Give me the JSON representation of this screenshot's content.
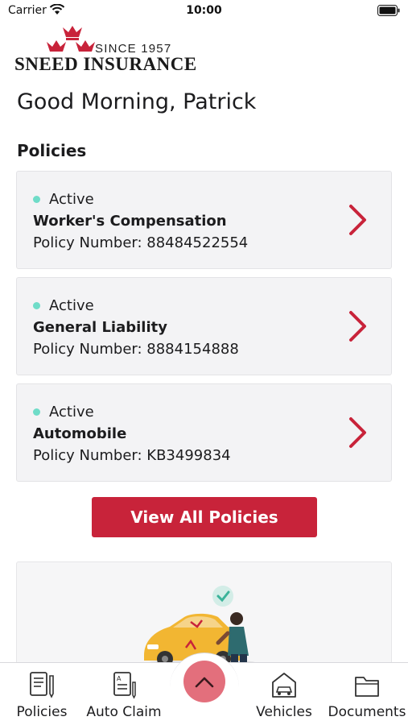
{
  "status_bar": {
    "carrier": "Carrier",
    "time": "10:00",
    "icons": [
      "wifi-icon",
      "battery-icon"
    ]
  },
  "logo": {
    "since": "SINCE 1957",
    "name": "SNEED INSURANCE",
    "icon": "crown-icon",
    "colors": {
      "crown": "#c8233a",
      "text": "#1a1a1a"
    }
  },
  "greeting": "Good Morning, Patrick",
  "policies_section": {
    "title": "Policies",
    "items": [
      {
        "status": "Active",
        "name": "Worker's Compensation",
        "number": "Policy Number: 88484522554"
      },
      {
        "status": "Active",
        "name": "General Liability",
        "number": "Policy Number: 8884154888"
      },
      {
        "status": "Active",
        "name": "Automobile",
        "number": "Policy Number: KB3499834"
      }
    ],
    "view_all_label": "View All Policies"
  },
  "promo": {
    "illustration": "car-inspection-illustration"
  },
  "tab_bar": {
    "items": [
      {
        "label": "Policies",
        "icon": "document-pen-icon"
      },
      {
        "label": "Auto Claim",
        "icon": "claim-form-icon"
      },
      {
        "label": "Vehicles",
        "icon": "garage-car-icon"
      },
      {
        "label": "Documents",
        "icon": "folder-icon"
      }
    ],
    "center_button_icon": "chevron-up-icon"
  },
  "colors": {
    "accent": "#c8233a",
    "active_dot": "#6fdcc8",
    "card_bg": "#f3f3f5",
    "fab": "#e36f7c"
  }
}
